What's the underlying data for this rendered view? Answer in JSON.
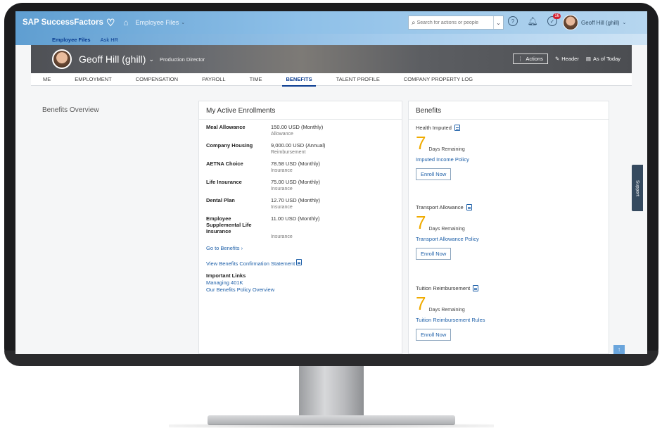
{
  "shell": {
    "brand": "SAP SuccessFactors",
    "menu_label": "Employee Files",
    "search_placeholder": "Search for actions or people",
    "notification_count": "16",
    "user_name": "Geoff Hill (ghill)"
  },
  "subnav": {
    "items": [
      "Employee Files",
      "Ask HR"
    ]
  },
  "employee": {
    "name": "Geoff Hill (ghill)",
    "title": "Production Director",
    "actions_label": "Actions",
    "header_label": "Header",
    "as_of_label": "As of Today"
  },
  "tabs": [
    "ME",
    "EMPLOYMENT",
    "COMPENSATION",
    "PAYROLL",
    "TIME",
    "BENEFITS",
    "TALENT PROFILE",
    "COMPANY PROPERTY LOG"
  ],
  "left_panel": {
    "title": "Benefits Overview"
  },
  "enrollments": {
    "title": "My Active Enrollments",
    "rows": [
      {
        "label": "Meal Allowance",
        "value": "150.00 USD (Monthly)",
        "sub": "Allowance"
      },
      {
        "label": "Company Housing",
        "value": "9,000.00 USD (Annual)",
        "sub": "Reimbursement"
      },
      {
        "label": "AETNA Choice",
        "value": "78.58 USD (Monthly)",
        "sub": "Insurance"
      },
      {
        "label": "Life Insurance",
        "value": "75.00 USD (Monthly)",
        "sub": "Insurance"
      },
      {
        "label": "Dental Plan",
        "value": "12.70 USD (Monthly)",
        "sub": "Insurance"
      },
      {
        "label": "Employee Supplemental Life Insurance",
        "value": "11.00 USD (Monthly)",
        "sub": "Insurance"
      }
    ],
    "go_to_benefits": "Go to Benefits",
    "confirmation_link": "View Benefits Confirmation Statement",
    "important_links_title": "Important Links",
    "links": [
      "Managing 401K",
      "Our Benefits Policy Overview"
    ]
  },
  "benefits": {
    "title": "Benefits",
    "sections": [
      {
        "title": "Health Imputed",
        "days": "7",
        "days_label": "Days Remaining",
        "policy": "Imputed Income Policy",
        "button": "Enroll Now"
      },
      {
        "title": "Transport Allowance",
        "days": "7",
        "days_label": "Days Remaining",
        "policy": "Transport Allowance Policy",
        "button": "Enroll Now"
      },
      {
        "title": "Tuition Reimbursement",
        "days": "7",
        "days_label": "Days Remaining",
        "policy": "Tuition Reimbursement Rules",
        "button": "Enroll Now"
      }
    ]
  },
  "support_label": "Support",
  "colors": {
    "accent": "#0b3d91",
    "link": "#1d5fa8",
    "days": "#f0ab00"
  }
}
